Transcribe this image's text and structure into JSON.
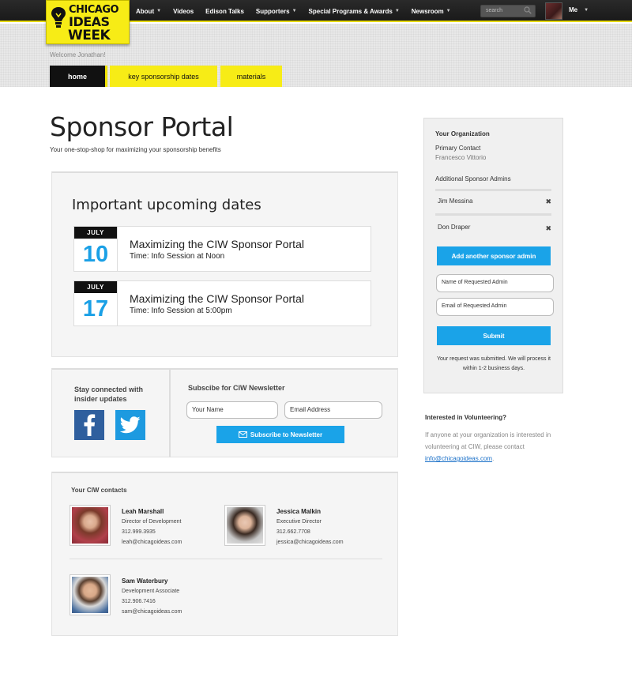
{
  "header": {
    "logo": {
      "line1": "CHICAGO",
      "line2": "IDEAS",
      "line3": "WEEK"
    },
    "nav": [
      {
        "label": "About",
        "dropdown": true
      },
      {
        "label": "Videos",
        "dropdown": false
      },
      {
        "label": "Edison Talks",
        "dropdown": false
      },
      {
        "label": "Supporters",
        "dropdown": true
      },
      {
        "label": "Special Programs & Awards",
        "dropdown": true
      },
      {
        "label": "Newsroom",
        "dropdown": true
      }
    ],
    "search_placeholder": "search",
    "user_label": "Me"
  },
  "welcome": "Welcome Jonathan!",
  "tabs": [
    {
      "label": "home",
      "active": true
    },
    {
      "label": "key sponsorship dates",
      "active": false
    },
    {
      "label": "materials",
      "active": false
    }
  ],
  "page": {
    "title": "Sponsor Portal",
    "subtitle": "Your one-stop-shop for maximizing your sponsorship benefits"
  },
  "dates": {
    "heading": "Important upcoming dates",
    "events": [
      {
        "month": "JULY",
        "day": "10",
        "title": "Maximizing the CIW Sponsor Portal",
        "time": "Time: Info Session at Noon"
      },
      {
        "month": "JULY",
        "day": "17",
        "title": "Maximizing the CIW Sponsor Portal",
        "time": "Time: Info Session at 5:00pm"
      }
    ]
  },
  "social": {
    "stay_connected": "Stay connected with insider updates",
    "newsletter_heading": "Subscibe for CIW Newsletter",
    "name_placeholder": "Your Name",
    "email_placeholder": "Email Address",
    "subscribe_label": "Subscribe to Newsletter"
  },
  "contacts": {
    "heading": "Your CIW contacts",
    "people": [
      {
        "name": "Leah Marshall",
        "role": "Director of Development",
        "phone": "312.999.3935",
        "email": "leah@chicagoideas.com"
      },
      {
        "name": "Jessica Malkin",
        "role": "Executive Director",
        "phone": "312.662.7708",
        "email": "jessica@chicagoideas.com"
      },
      {
        "name": "Sam Waterbury",
        "role": "Development Associate",
        "phone": "312.906.7416",
        "email": "sam@chicagoideas.com"
      }
    ]
  },
  "org": {
    "heading": "Your Organization",
    "primary_contact_label": "Primary Contact",
    "primary_contact_name": "Francesco Vittorio",
    "admins_label": "Additional Sponsor Admins",
    "admins": [
      "Jim Messina",
      "Don Draper"
    ],
    "add_admin_label": "Add another sponsor admin",
    "name_placeholder": "Name of Requested Admin",
    "email_placeholder": "Email of Requested Admin",
    "submit_label": "Submit",
    "request_message": "Your request was submitted. We will process it within 1-2 business days."
  },
  "volunteer": {
    "heading": "Interested in Volunteering?",
    "text": "If anyone at your organization is interested in volunteering at CIW, please contact ",
    "email": "info@chicagoideas.com",
    "text_end": "."
  },
  "colors": {
    "brand_yellow": "#f7ec16",
    "accent_blue": "#1aa3e8",
    "nav_dark": "#1f1f1f"
  }
}
